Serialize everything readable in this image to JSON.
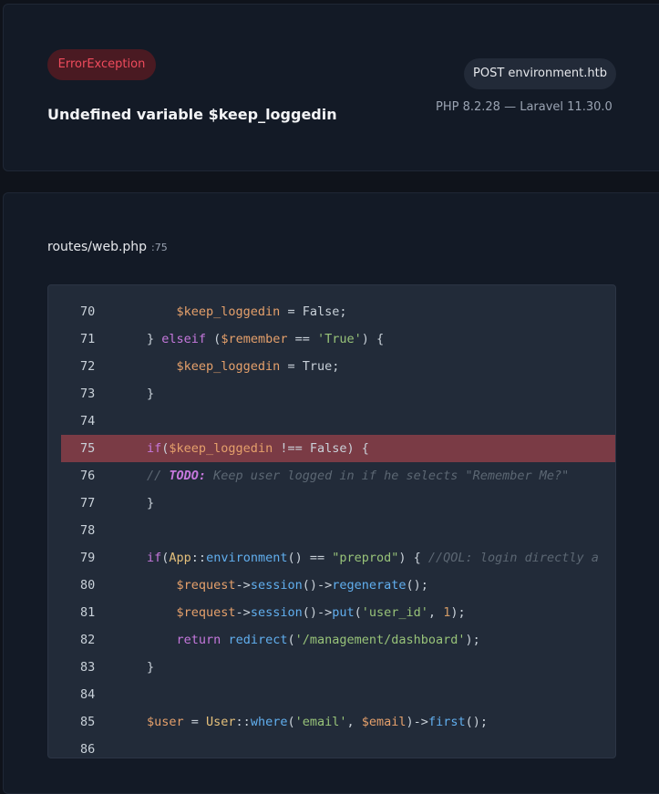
{
  "error": {
    "badge": "ErrorException",
    "title": "Undefined variable $keep_loggedin",
    "request": "POST environment.htb",
    "versions": "PHP 8.2.28 — Laravel 11.30.0"
  },
  "file": {
    "path": "routes/web.php",
    "line_ref": ":75"
  },
  "code": {
    "highlight_line": 75,
    "lines": [
      {
        "n": "70",
        "indent": 8,
        "tokens": [
          [
            "var",
            "$keep_loggedin"
          ],
          [
            "p",
            " = False;"
          ]
        ]
      },
      {
        "n": "71",
        "indent": 4,
        "tokens": [
          [
            "p",
            "} "
          ],
          [
            "kw",
            "elseif"
          ],
          [
            "p",
            " ("
          ],
          [
            "var",
            "$remember"
          ],
          [
            "p",
            " == "
          ],
          [
            "str",
            "'True'"
          ],
          [
            "p",
            ") {"
          ]
        ]
      },
      {
        "n": "72",
        "indent": 8,
        "tokens": [
          [
            "var",
            "$keep_loggedin"
          ],
          [
            "p",
            " = True;"
          ]
        ]
      },
      {
        "n": "73",
        "indent": 4,
        "tokens": [
          [
            "p",
            "}"
          ]
        ]
      },
      {
        "n": "74",
        "indent": 0,
        "tokens": []
      },
      {
        "n": "75",
        "indent": 4,
        "tokens": [
          [
            "kw",
            "if"
          ],
          [
            "p",
            "("
          ],
          [
            "var",
            "$keep_loggedin"
          ],
          [
            "p",
            " !== False) {"
          ]
        ]
      },
      {
        "n": "76",
        "indent": 4,
        "tokens": [
          [
            "cm",
            "// "
          ],
          [
            "todo",
            "TODO:"
          ],
          [
            "cm",
            " Keep user logged in if he selects \"Remember Me?\""
          ]
        ]
      },
      {
        "n": "77",
        "indent": 4,
        "tokens": [
          [
            "p",
            "}"
          ]
        ]
      },
      {
        "n": "78",
        "indent": 0,
        "tokens": []
      },
      {
        "n": "79",
        "indent": 4,
        "tokens": [
          [
            "kw",
            "if"
          ],
          [
            "p",
            "("
          ],
          [
            "cls",
            "App"
          ],
          [
            "p",
            "::"
          ],
          [
            "fn",
            "environment"
          ],
          [
            "p",
            "() == "
          ],
          [
            "str",
            "\"preprod\""
          ],
          [
            "p",
            ") { "
          ],
          [
            "cm",
            "//QOL: login directly a"
          ]
        ]
      },
      {
        "n": "80",
        "indent": 8,
        "tokens": [
          [
            "var",
            "$request"
          ],
          [
            "p",
            "->"
          ],
          [
            "fn",
            "session"
          ],
          [
            "p",
            "()->"
          ],
          [
            "fn",
            "regenerate"
          ],
          [
            "p",
            "();"
          ]
        ]
      },
      {
        "n": "81",
        "indent": 8,
        "tokens": [
          [
            "var",
            "$request"
          ],
          [
            "p",
            "->"
          ],
          [
            "fn",
            "session"
          ],
          [
            "p",
            "()->"
          ],
          [
            "fn",
            "put"
          ],
          [
            "p",
            "("
          ],
          [
            "str",
            "'user_id'"
          ],
          [
            "p",
            ", "
          ],
          [
            "num",
            "1"
          ],
          [
            "p",
            ");"
          ]
        ]
      },
      {
        "n": "82",
        "indent": 8,
        "tokens": [
          [
            "kw",
            "return"
          ],
          [
            "p",
            " "
          ],
          [
            "fn",
            "redirect"
          ],
          [
            "p",
            "("
          ],
          [
            "str",
            "'/management/dashboard'"
          ],
          [
            "p",
            ");"
          ]
        ]
      },
      {
        "n": "83",
        "indent": 4,
        "tokens": [
          [
            "p",
            "}"
          ]
        ]
      },
      {
        "n": "84",
        "indent": 0,
        "tokens": []
      },
      {
        "n": "85",
        "indent": 4,
        "tokens": [
          [
            "var",
            "$user"
          ],
          [
            "p",
            " = "
          ],
          [
            "cls",
            "User"
          ],
          [
            "p",
            "::"
          ],
          [
            "fn",
            "where"
          ],
          [
            "p",
            "("
          ],
          [
            "str",
            "'email'"
          ],
          [
            "p",
            ", "
          ],
          [
            "var",
            "$email"
          ],
          [
            "p",
            ")->"
          ],
          [
            "fn",
            "first"
          ],
          [
            "p",
            "();"
          ]
        ]
      },
      {
        "n": "86",
        "indent": 0,
        "tokens": []
      }
    ]
  },
  "colors": {
    "badge_text": "#ef4b5c",
    "badge_bg": "#4a1a22",
    "highlight_bg": "#7a3b45"
  }
}
